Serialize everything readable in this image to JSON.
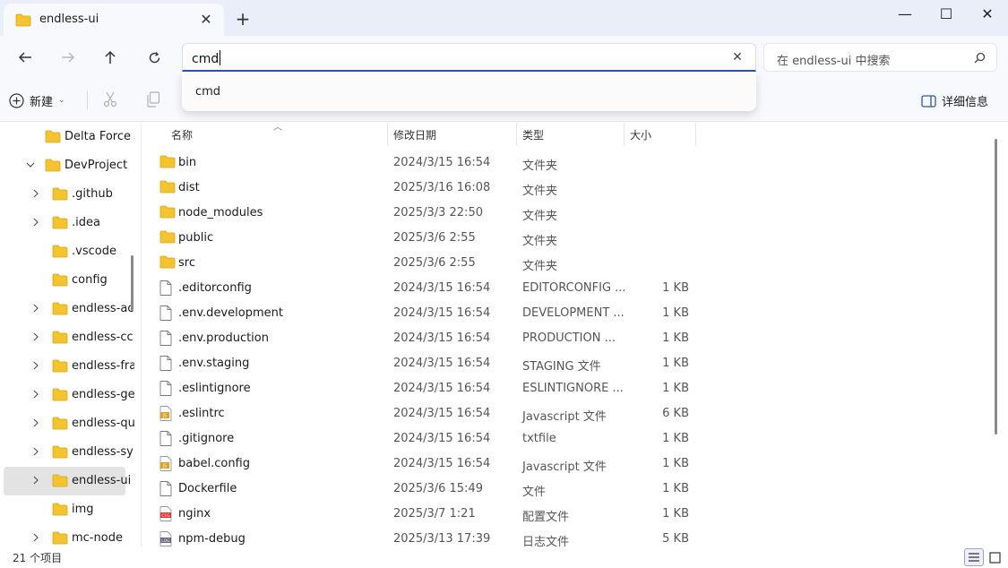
{
  "window": {
    "tab_title": "endless-ui",
    "new_tab": "+",
    "minimize": "—",
    "maximize": "☐",
    "close": "✕",
    "tab_close": "✕"
  },
  "address": {
    "value": "cmd",
    "clear": "✕",
    "search_placeholder": "在 endless-ui 中搜索"
  },
  "suggestions": [
    "cmd"
  ],
  "toolbar": {
    "new_label": "新建",
    "details_label": "详细信息"
  },
  "sidebar": {
    "items": [
      {
        "label": "Delta Force",
        "chevron": "none",
        "indent": 1
      },
      {
        "label": "DevProject",
        "chevron": "down",
        "indent": 1
      },
      {
        "label": ".github",
        "chevron": "right",
        "indent": 2
      },
      {
        "label": ".idea",
        "chevron": "right",
        "indent": 2
      },
      {
        "label": ".vscode",
        "chevron": "none",
        "indent": 2
      },
      {
        "label": "config",
        "chevron": "none",
        "indent": 2
      },
      {
        "label": "endless-ac",
        "chevron": "right",
        "indent": 2
      },
      {
        "label": "endless-cc",
        "chevron": "right",
        "indent": 2
      },
      {
        "label": "endless-fra",
        "chevron": "right",
        "indent": 2
      },
      {
        "label": "endless-ge",
        "chevron": "right",
        "indent": 2
      },
      {
        "label": "endless-qu",
        "chevron": "right",
        "indent": 2
      },
      {
        "label": "endless-sy",
        "chevron": "right",
        "indent": 2
      },
      {
        "label": "endless-ui",
        "chevron": "right",
        "indent": 2,
        "selected": true
      },
      {
        "label": "img",
        "chevron": "none",
        "indent": 2
      },
      {
        "label": "mc-node",
        "chevron": "right",
        "indent": 2
      }
    ]
  },
  "columns": {
    "name": "名称",
    "date": "修改日期",
    "type": "类型",
    "size": "大小"
  },
  "files": [
    {
      "name": "bin",
      "date": "2024/3/15 16:54",
      "type": "文件夹",
      "size": "",
      "icon": "folder"
    },
    {
      "name": "dist",
      "date": "2025/3/16 16:08",
      "type": "文件夹",
      "size": "",
      "icon": "folder"
    },
    {
      "name": "node_modules",
      "date": "2025/3/3 22:50",
      "type": "文件夹",
      "size": "",
      "icon": "folder"
    },
    {
      "name": "public",
      "date": "2025/3/6 2:55",
      "type": "文件夹",
      "size": "",
      "icon": "folder"
    },
    {
      "name": "src",
      "date": "2025/3/6 2:55",
      "type": "文件夹",
      "size": "",
      "icon": "folder"
    },
    {
      "name": ".editorconfig",
      "date": "2024/3/15 16:54",
      "type": "EDITORCONFIG ...",
      "size": "1 KB",
      "icon": "file"
    },
    {
      "name": ".env.development",
      "date": "2024/3/15 16:54",
      "type": "DEVELOPMENT ...",
      "size": "1 KB",
      "icon": "file"
    },
    {
      "name": ".env.production",
      "date": "2024/3/15 16:54",
      "type": "PRODUCTION ...",
      "size": "1 KB",
      "icon": "file"
    },
    {
      "name": ".env.staging",
      "date": "2024/3/15 16:54",
      "type": "STAGING 文件",
      "size": "1 KB",
      "icon": "file"
    },
    {
      "name": ".eslintignore",
      "date": "2024/3/15 16:54",
      "type": "ESLINTIGNORE ...",
      "size": "1 KB",
      "icon": "file"
    },
    {
      "name": ".eslintrc",
      "date": "2024/3/15 16:54",
      "type": "Javascript 文件",
      "size": "6 KB",
      "icon": "js"
    },
    {
      "name": ".gitignore",
      "date": "2024/3/15 16:54",
      "type": "txtfile",
      "size": "1 KB",
      "icon": "file"
    },
    {
      "name": "babel.config",
      "date": "2024/3/15 16:54",
      "type": "Javascript 文件",
      "size": "1 KB",
      "icon": "js"
    },
    {
      "name": "Dockerfile",
      "date": "2025/3/6 15:49",
      "type": "文件",
      "size": "1 KB",
      "icon": "file"
    },
    {
      "name": "nginx",
      "date": "2025/3/7 1:21",
      "type": "配置文件",
      "size": "1 KB",
      "icon": "cfg"
    },
    {
      "name": "npm-debug",
      "date": "2025/3/13 17:39",
      "type": "日志文件",
      "size": "5 KB",
      "icon": "log"
    }
  ],
  "status": {
    "item_count": "21 个项目"
  },
  "colors": {
    "accent": "#2c5aa0",
    "folder": "#f4c430",
    "chrome": "#e9eef8",
    "selected": "#e3e3e3"
  }
}
